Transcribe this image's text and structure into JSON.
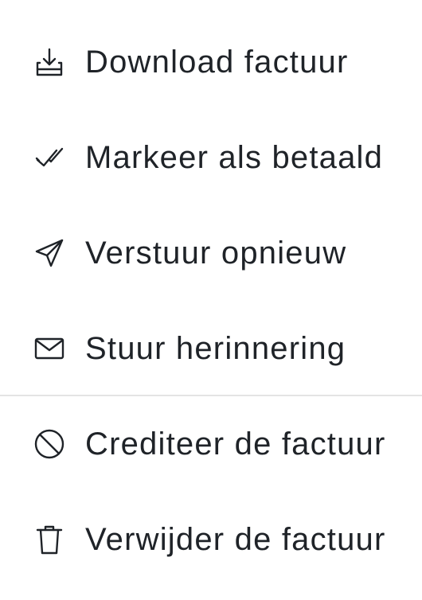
{
  "menu": {
    "items": [
      {
        "label": "Download factuur",
        "icon": "download-tray-icon"
      },
      {
        "label": "Markeer als betaald",
        "icon": "check-double-icon"
      },
      {
        "label": "Verstuur opnieuw",
        "icon": "paper-plane-icon"
      },
      {
        "label": "Stuur herinnering",
        "icon": "envelope-icon"
      },
      {
        "label": "Crediteer de factuur",
        "icon": "prohibited-icon"
      },
      {
        "label": "Verwijder de factuur",
        "icon": "trash-icon"
      }
    ]
  },
  "colors": {
    "text": "#1f2328",
    "divider": "#e4e4e4",
    "background": "#ffffff"
  }
}
